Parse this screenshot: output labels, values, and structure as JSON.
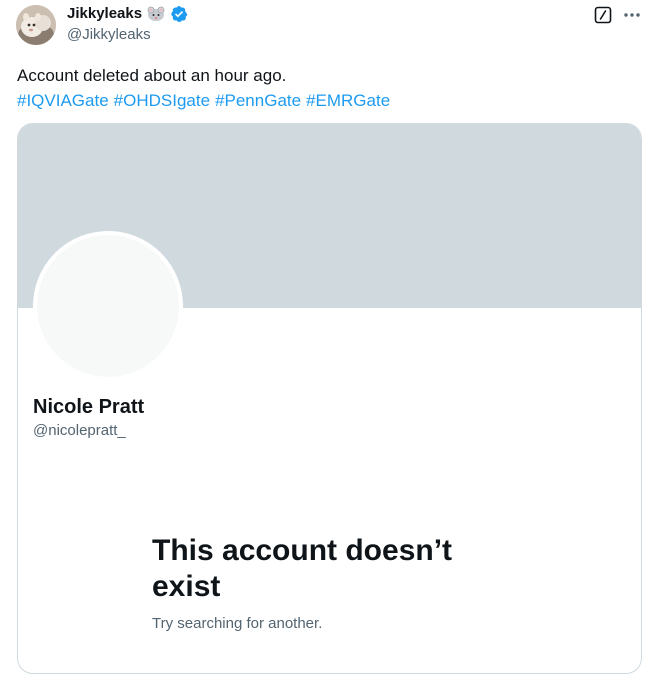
{
  "author": {
    "name": "Jikkyleaks",
    "handle": "@Jikkyleaks",
    "name_emoji": "rat-emoji-icon",
    "verified_icon": "verified-badge-icon",
    "verified_color": "#1d9bf0"
  },
  "tweet": {
    "text": "Account deleted about an hour ago.",
    "hashtags": [
      "#IQVIAGate",
      "#OHDSIgate",
      "#PennGate",
      "#EMRGate"
    ],
    "hashtag_color": "#1d9bf0"
  },
  "actions": {
    "grok_icon": "grok-icon",
    "more_icon": "more-icon"
  },
  "card": {
    "profile_name": "Nicole Pratt",
    "profile_handle": "@nicolepratt_",
    "empty_title": "This account doesn’t exist",
    "empty_subtitle": "Try searching for another.",
    "banner_color": "#cfd9de",
    "avatar_color": "#f7f9f9"
  }
}
